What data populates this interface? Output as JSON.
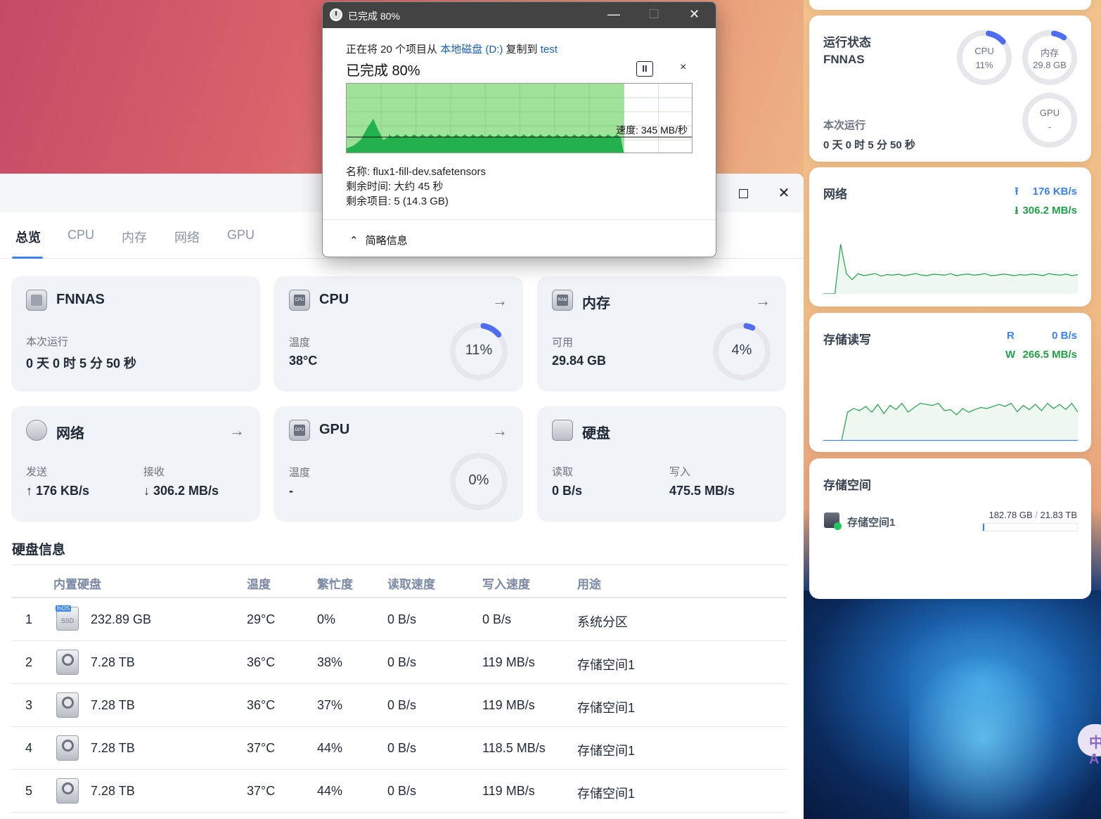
{
  "colors": {
    "accent": "#3b82f6",
    "ring_track": "#e5e7eb",
    "ring_fill": "#4f6cf5",
    "green": "#22b14c",
    "green_light": "#9fe29a"
  },
  "window": {
    "tabs": [
      "总览",
      "CPU",
      "内存",
      "网络",
      "GPU"
    ],
    "active_tab": 0
  },
  "cards": {
    "fnnas": {
      "title": "FNNAS",
      "label": "本次运行",
      "value": "0 天 0 时 5 分 50 秒"
    },
    "cpu": {
      "title": "CPU",
      "label": "温度",
      "value": "38°C",
      "ring": "11%",
      "percent": 11,
      "chip": "CPU"
    },
    "mem": {
      "title": "内存",
      "label": "可用",
      "value": "29.84 GB",
      "ring": "4%",
      "percent": 4,
      "chip": "RAM"
    },
    "net": {
      "title": "网络",
      "send_label": "发送",
      "send_value": "↑ 176 KB/s",
      "recv_label": "接收",
      "recv_value": "↓ 306.2 MB/s"
    },
    "gpu": {
      "title": "GPU",
      "label": "温度",
      "value": "-",
      "ring": "0%",
      "percent": 0,
      "chip": "GPU"
    },
    "disk": {
      "title": "硬盘",
      "read_label": "读取",
      "read_value": "0 B/s",
      "write_label": "写入",
      "write_value": "475.5 MB/s"
    }
  },
  "disk_info": {
    "title": "硬盘信息",
    "headers": [
      "内置硬盘",
      "温度",
      "繁忙度",
      "读取速度",
      "写入速度",
      "用途"
    ],
    "ssd_badge": "fnOS",
    "ssd_label": "SSD",
    "rows": [
      {
        "no": "1",
        "size": "232.89 GB",
        "temp": "29°C",
        "busy": "0%",
        "read": "0 B/s",
        "write": "0 B/s",
        "use": "系统分区",
        "type": "ssd"
      },
      {
        "no": "2",
        "size": "7.28 TB",
        "temp": "36°C",
        "busy": "38%",
        "read": "0 B/s",
        "write": "119 MB/s",
        "use": "存储空间1",
        "type": "hdd"
      },
      {
        "no": "3",
        "size": "7.28 TB",
        "temp": "36°C",
        "busy": "37%",
        "read": "0 B/s",
        "write": "119 MB/s",
        "use": "存储空间1",
        "type": "hdd"
      },
      {
        "no": "4",
        "size": "7.28 TB",
        "temp": "37°C",
        "busy": "44%",
        "read": "0 B/s",
        "write": "118.5 MB/s",
        "use": "存储空间1",
        "type": "hdd"
      },
      {
        "no": "5",
        "size": "7.28 TB",
        "temp": "37°C",
        "busy": "44%",
        "read": "0 B/s",
        "write": "119 MB/s",
        "use": "存储空间1",
        "type": "hdd"
      }
    ]
  },
  "dialog": {
    "title": "已完成 80%",
    "line_prefix": "正在将 20 个项目从 ",
    "source": "本地磁盘 (D:)",
    "line_mid": " 复制到 ",
    "dest": "test",
    "progress_text": "已完成 80%",
    "progress": 0.8,
    "speed": "速度: 345 MB/秒",
    "name": "名称: flux1-fill-dev.safetensors",
    "remaining_time": "剩余时间: 大约 45 秒",
    "remaining_items": "剩余项目: 5 (14.3 GB)",
    "details_toggle": "简略信息",
    "pause_icon": "II",
    "close_icon": "×"
  },
  "widgets": {
    "status": {
      "title": "运行状态",
      "host": "FNNAS",
      "uptime_label": "本次运行",
      "uptime": "0 天 0 时 5 分 50 秒",
      "cpu_label": "CPU",
      "cpu_value": "11%",
      "cpu_percent": 11,
      "mem_label": "内存",
      "mem_value": "29.8 GB",
      "mem_percent": 7,
      "gpu_label": "GPU",
      "gpu_value": "-",
      "gpu_percent": 0
    },
    "network": {
      "title": "网络",
      "up": "176 KB/s",
      "down": "306.2 MB/s"
    },
    "storage_io": {
      "title": "存储读写",
      "r_label": "R",
      "r_value": "0 B/s",
      "w_label": "W",
      "w_value": "266.5 MB/s"
    },
    "storage": {
      "title": "存储空间",
      "pool": "存储空间1",
      "used": "182.78 GB",
      "total": "21.83 TB",
      "used_fraction": 0.008
    }
  },
  "lang_chip": "中A"
}
